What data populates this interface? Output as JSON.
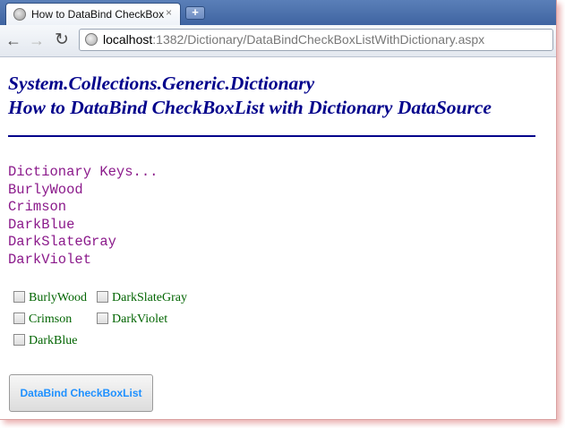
{
  "browser": {
    "tab_title": "How to DataBind CheckBox",
    "tab_close": "×",
    "new_tab": "+",
    "url_host": "localhost",
    "url_rest": ":1382/Dictionary/DataBindCheckBoxListWithDictionary.aspx"
  },
  "page": {
    "heading_line1": "System.Collections.Generic.Dictionary",
    "heading_line2": "How to DataBind CheckBoxList with Dictionary DataSource",
    "keys_label": "Dictionary Keys...",
    "keys": [
      "BurlyWood",
      "Crimson",
      "DarkBlue",
      "DarkSlateGray",
      "DarkViolet"
    ],
    "checkboxes": [
      "BurlyWood",
      "Crimson",
      "DarkBlue",
      "DarkSlateGray",
      "DarkViolet"
    ],
    "button_label": "DataBind CheckBoxList"
  },
  "colors": {
    "heading": "#00008b",
    "keys_text": "#8b1a8b",
    "checkbox_text": "#006400",
    "button_text": "#1e90ff"
  }
}
